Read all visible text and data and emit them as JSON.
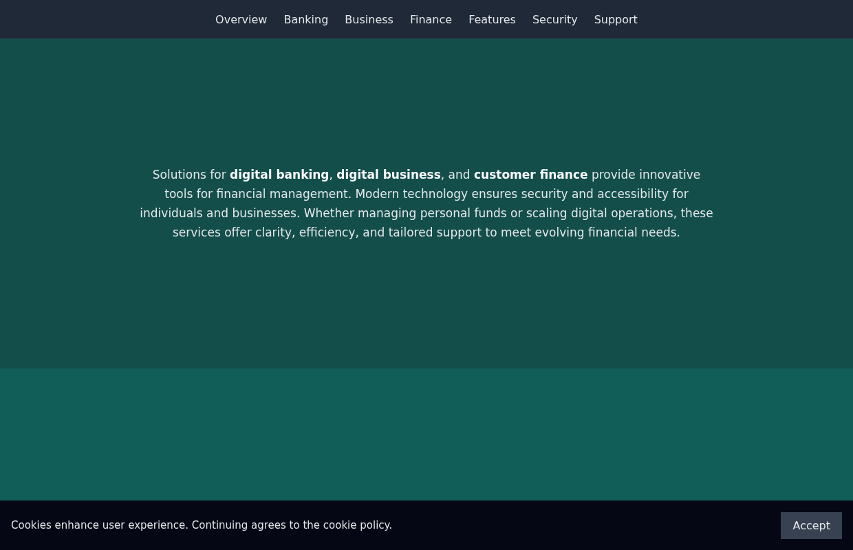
{
  "nav": {
    "items": [
      "Overview",
      "Banking",
      "Business",
      "Finance",
      "Features",
      "Security",
      "Support"
    ]
  },
  "sections": [
    {
      "text": "Solutions for **digital banking**, **digital business**, and **customer finance** provide innovative tools for financial management. Modern technology ensures security and accessibility for individuals and businesses. Whether managing personal funds or scaling digital operations, these services offer clarity, efficiency, and tailored support to meet evolving financial needs."
    }
  ],
  "cookie_banner": {
    "message": "Cookies enhance user experience. Continuing agrees to the cookie policy.",
    "button": "Accept"
  }
}
